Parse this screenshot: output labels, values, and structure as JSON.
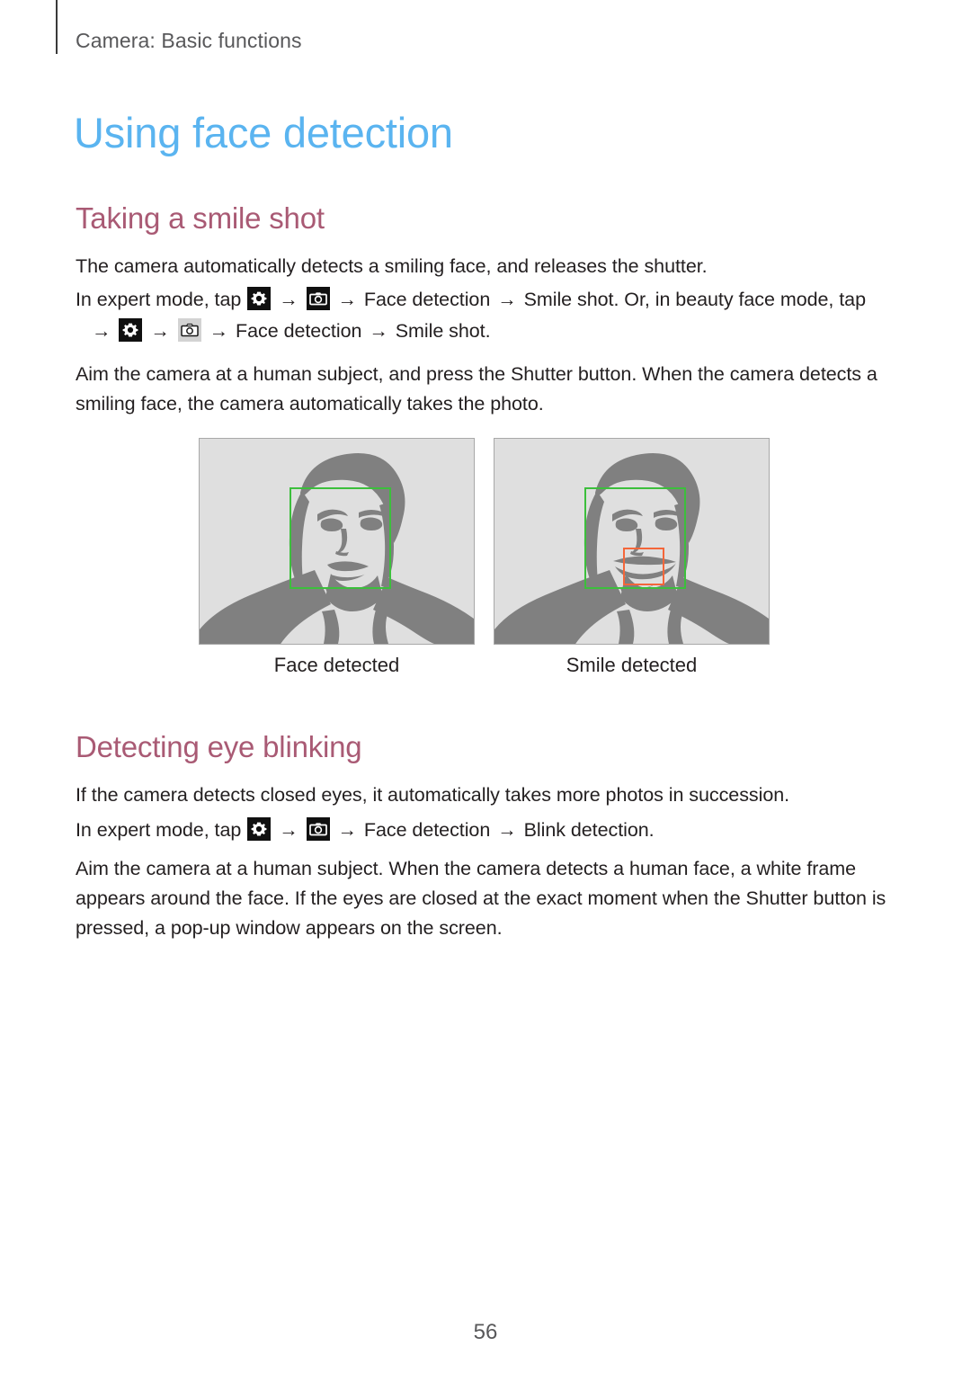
{
  "running_head": "Camera: Basic functions",
  "page_title": "Using face detection",
  "sections": [
    {
      "heading": "Taking a smile shot",
      "paragraphs": {
        "intro": "The camera automatically detects a smiling face, and releases the shutter.",
        "steps_lead": "In expert mode, tap",
        "steps_mid": "Face detection",
        "steps_tail": "Smile shot. Or, in beauty face mode, tap",
        "steps2_mid": "Face detection",
        "steps2_tail": "Smile shot.",
        "body": "Aim the camera at a human subject, and press the Shutter button. When the camera detects a smiling face, the camera automatically takes the photo."
      }
    },
    {
      "heading": "Detecting eye blinking",
      "paragraphs": {
        "intro": "If the camera detects closed eyes, it automatically takes more photos in succession.",
        "steps_lead": "In expert mode, tap",
        "steps_mid": "Face detection",
        "steps_tail": "Blink detection.",
        "body": "Aim the camera at a human subject. When the camera detects a human face, a white frame appears around the face. If the eyes are closed at the exact moment when the Shutter button is pressed, a pop-up window appears on the screen."
      }
    }
  ],
  "arrow": "→",
  "icons": {
    "settings": "gear-icon",
    "camera": "camera-icon"
  },
  "figures": [
    {
      "caption": "Face detected",
      "face_box_color": "#3cbf3c",
      "smile_box_color": null
    },
    {
      "caption": "Smile detected",
      "face_box_color": "#3cbf3c",
      "smile_box_color": "#f4663a"
    }
  ],
  "page_number": "56",
  "colors": {
    "title_blue": "#5ab4f0",
    "heading_mauve": "#a95a74",
    "body_text": "#231f20",
    "running_head": "#58585a",
    "figure_bg": "#dfdfdf",
    "figure_ink": "#808080"
  }
}
